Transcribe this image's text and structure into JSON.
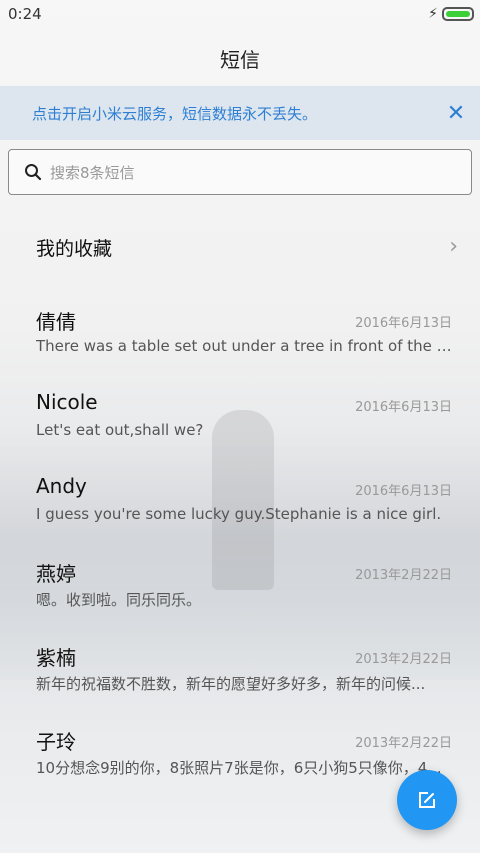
{
  "status": {
    "time": "0:24",
    "charging_icon": "bolt-icon",
    "battery_icon": "battery-icon",
    "battery_color": "#3ccf37"
  },
  "header": {
    "title": "短信"
  },
  "banner": {
    "text": "点击开启小米云服务，短信数据永不丢失。",
    "close_icon": "close-icon",
    "accent_color": "#2d7fd3"
  },
  "search": {
    "placeholder": "搜索8条短信",
    "icon": "search-icon"
  },
  "favorites": {
    "label": "我的收藏",
    "chevron_icon": "chevron-right-icon"
  },
  "conversations": [
    {
      "name": "倩倩",
      "date": "2016年6月13日",
      "snippet": "There was a table set out under a tree in front of the ho..."
    },
    {
      "name": "Nicole",
      "date": "2016年6月13日",
      "snippet": "Let's eat out,shall we?"
    },
    {
      "name": "Andy",
      "date": "2016年6月13日",
      "snippet": "I guess you're some lucky guy.Stephanie is a nice girl."
    },
    {
      "name": "燕婷",
      "date": "2013年2月22日",
      "snippet": "嗯。收到啦。同乐同乐。"
    },
    {
      "name": "紫楠",
      "date": "2013年2月22日",
      "snippet": "新年的祝福数不胜数，新年的愿望好多好多，新年的问候..."
    },
    {
      "name": "子玲",
      "date": "2013年2月22日",
      "snippet": "10分想念9别的你，8张照片7张是你，6只小狗5只像你，4..."
    }
  ],
  "fab": {
    "icon": "compose-icon",
    "color": "#2196f3"
  }
}
